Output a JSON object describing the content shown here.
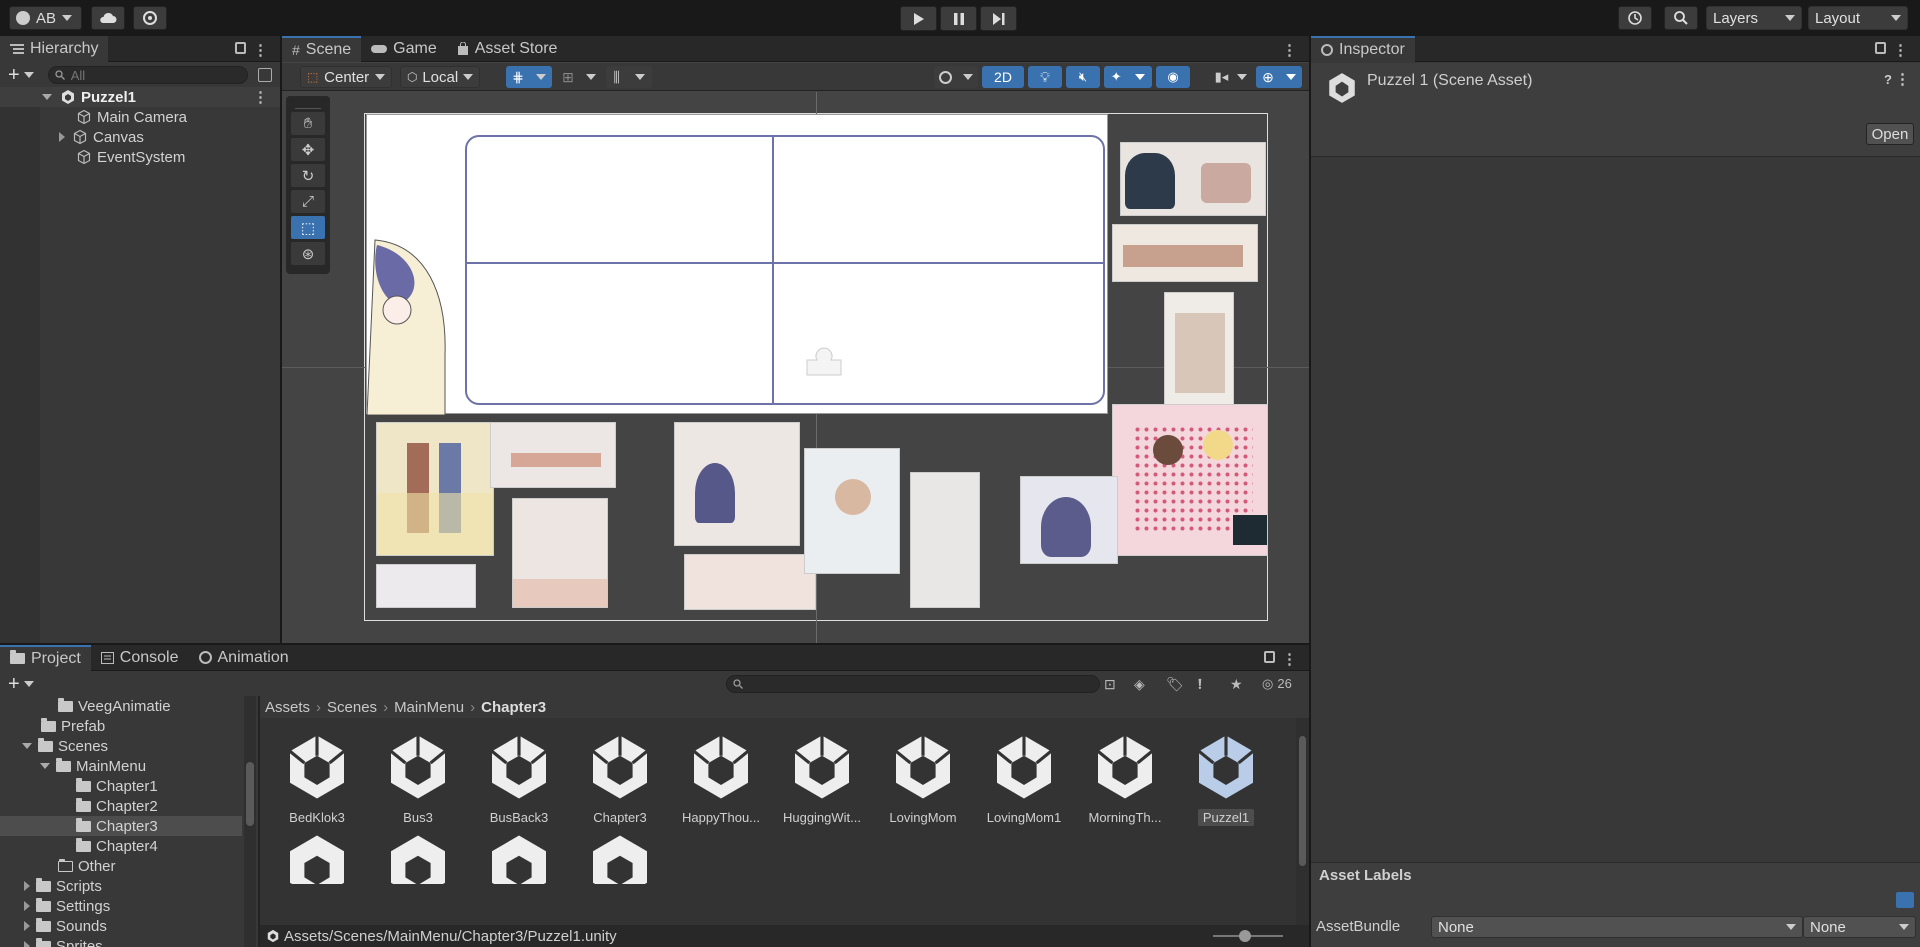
{
  "toolbar": {
    "account_label": "AB",
    "layers_label": "Layers",
    "layout_label": "Layout"
  },
  "hierarchy": {
    "tab_label": "Hierarchy",
    "search_placeholder": "All",
    "scene_name": "Puzzel1",
    "items": [
      {
        "label": "Main Camera"
      },
      {
        "label": "Canvas"
      },
      {
        "label": "EventSystem"
      }
    ]
  },
  "scene_tabs": {
    "scene": "Scene",
    "game": "Game",
    "asset_store": "Asset Store"
  },
  "scene_toolbar": {
    "pivot": "Center",
    "space": "Local",
    "mode_2d": "2D"
  },
  "inspector": {
    "tab_label": "Inspector",
    "title": "Puzzel 1 (Scene Asset)",
    "open_button": "Open",
    "asset_labels": "Asset Labels",
    "asset_bundle_label": "AssetBundle",
    "bundle_value": "None",
    "variant_value": "None"
  },
  "bottom_tabs": {
    "project": "Project",
    "console": "Console",
    "animation": "Animation"
  },
  "project": {
    "hidden_count": "26",
    "breadcrumb": [
      "Assets",
      "Scenes",
      "MainMenu",
      "Chapter3"
    ],
    "tree": [
      {
        "label": "VeegAnimatie"
      },
      {
        "label": "Prefab"
      },
      {
        "label": "Scenes"
      },
      {
        "label": "MainMenu"
      },
      {
        "label": "Chapter1"
      },
      {
        "label": "Chapter2"
      },
      {
        "label": "Chapter3"
      },
      {
        "label": "Chapter4"
      },
      {
        "label": "Other"
      },
      {
        "label": "Scripts"
      },
      {
        "label": "Settings"
      },
      {
        "label": "Sounds"
      },
      {
        "label": "Sprites"
      }
    ],
    "assets": [
      {
        "label": "BedKlok3"
      },
      {
        "label": "Bus3"
      },
      {
        "label": "BusBack3"
      },
      {
        "label": "Chapter3"
      },
      {
        "label": "HappyThou..."
      },
      {
        "label": "HuggingWit..."
      },
      {
        "label": "LovingMom"
      },
      {
        "label": "LovingMom1"
      },
      {
        "label": "MorningTh..."
      },
      {
        "label": "Puzzel1"
      }
    ],
    "status_path": "Assets/Scenes/MainMenu/Chapter3/Puzzel1.unity"
  },
  "colors": {
    "accent": "#3a72b0",
    "selected_row": "#2c5d87",
    "panel_bg": "#383838",
    "scene_bg": "#444444"
  }
}
